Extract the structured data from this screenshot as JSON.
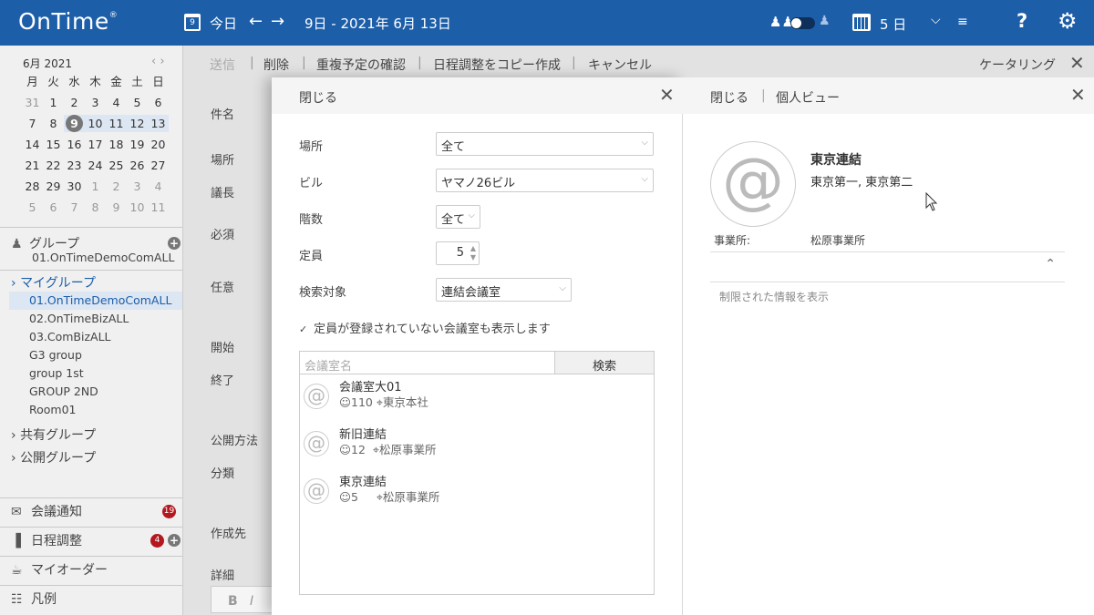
{
  "topbar": {
    "logo": "OnTime",
    "logo_reg": "®",
    "cal_day": "9",
    "today_label": "今日",
    "prev": "←",
    "next": "→",
    "date_range": "9日 - 2021年 6月 13日",
    "days_label": "5 日",
    "help": "?"
  },
  "mini_calendar": {
    "month": "6月 2021",
    "nav": "‹ ›",
    "weekdays": [
      "月",
      "火",
      "水",
      "木",
      "金",
      "土",
      "日"
    ],
    "weeks": [
      [
        "31",
        "1",
        "2",
        "3",
        "4",
        "5",
        "6"
      ],
      [
        "7",
        "8",
        "9",
        "10",
        "11",
        "12",
        "13"
      ],
      [
        "14",
        "15",
        "16",
        "17",
        "18",
        "19",
        "20"
      ],
      [
        "21",
        "22",
        "23",
        "24",
        "25",
        "26",
        "27"
      ],
      [
        "28",
        "29",
        "30",
        "1",
        "2",
        "3",
        "4"
      ],
      [
        "5",
        "6",
        "7",
        "8",
        "9",
        "10",
        "11"
      ]
    ]
  },
  "sidebar": {
    "group_title": "グループ",
    "group_sub": "01.OnTimeDemoComALL",
    "my_group": "マイグループ",
    "my_group_items": [
      "01.OnTimeDemoComALL",
      "02.OnTimeBizALL",
      "03.ComBizALL",
      "G3 group",
      "group 1st",
      "GROUP 2ND",
      "Room01"
    ],
    "shared_group": "共有グループ",
    "public_group": "公開グループ",
    "bottom": {
      "meeting_notice": "会議通知",
      "meeting_badge": "19",
      "schedule_adjust": "日程調整",
      "schedule_badge": "4",
      "my_order": "マイオーダー",
      "legend": "凡例"
    }
  },
  "toolbar": {
    "send": "送信",
    "delete": "削除",
    "check_dup": "重複予定の確認",
    "copy_adjust": "日程調整をコピー作成",
    "cancel": "キャンセル",
    "catering": "ケータリング"
  },
  "form_labels": [
    "件名",
    "場所",
    "議長",
    "必須",
    "任意",
    "開始",
    "終了",
    "公開方法",
    "分類",
    "作成先",
    "詳細"
  ],
  "editor": {
    "bold": "B",
    "italic": "I"
  },
  "room_panel": {
    "close": "閉じる",
    "location_label": "場所",
    "location_value": "全て",
    "building_label": "ビル",
    "building_value": "ヤマノ26ビル",
    "floor_label": "階数",
    "floor_value": "全て",
    "capacity_label": "定員",
    "capacity_value": "5",
    "search_target_label": "検索対象",
    "search_target_value": "連結会議室",
    "show_unregistered": "定員が登録されていない会議室も表示します",
    "search_placeholder": "会議室名",
    "search_button": "検索",
    "rooms": [
      {
        "name": "会議室大01",
        "cap": "110",
        "place": "東京本社"
      },
      {
        "name": "新旧連結",
        "cap": "12",
        "place": "松原事業所"
      },
      {
        "name": "東京連結",
        "cap": "5",
        "place": "松原事業所"
      }
    ]
  },
  "detail_panel": {
    "close": "閉じる",
    "personal_view": "個人ビュー",
    "avatar": "@",
    "name": "東京連結",
    "dept": "東京第一, 東京第二",
    "office_label": "事業所:",
    "office_value": "松原事業所",
    "restricted": "制限された情報を表示"
  },
  "colors": {
    "accent": "#1c5ea8",
    "badge": "#b3171f"
  }
}
